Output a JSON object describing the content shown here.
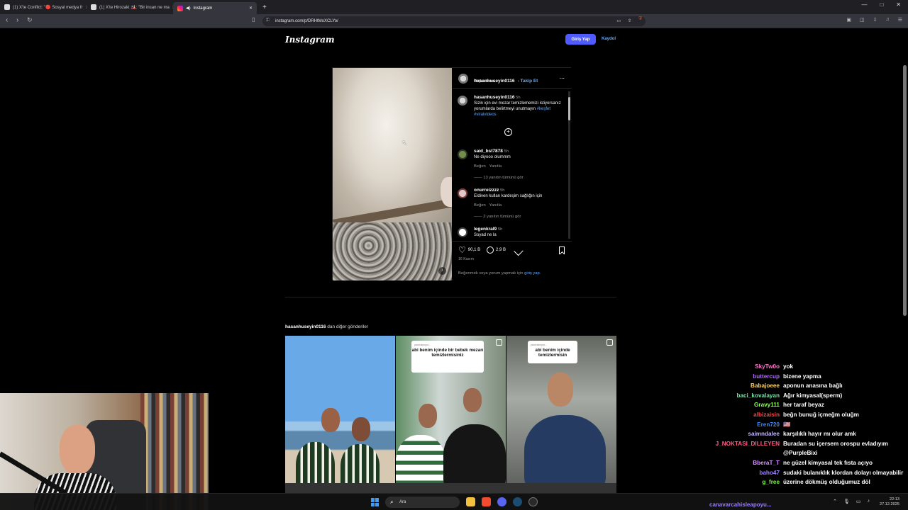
{
  "browser": {
    "tabs": [
      {
        "label": "(1) X'te Conflict: \"🔴 Sosyal medya fr"
      },
      {
        "label": "(1) X'te Hirozaki 🎎: \"Bir insan ne ma"
      },
      {
        "label": "Instagram"
      }
    ],
    "new_tab": "+",
    "url": "instagram.com/p/DRHtMoXCLYo/",
    "window_controls": [
      "—",
      "□",
      "✕"
    ]
  },
  "instagram": {
    "logo": "Instagram",
    "login_label": "Giriş Yap",
    "signup_label": "Kaydol",
    "post": {
      "author": "hasanhuseyin0116",
      "follow_label": "Takip Et",
      "audio": "Orijinal ses",
      "more_label": "...",
      "caption_time": "5h",
      "caption": "Sizin için evi mezar temizlememizi istiyorsanız yorumlarda belirtmeyi unutmayın",
      "hashtags": "#keşfet #viralvideos",
      "comments": [
        {
          "user": "said_bst7878",
          "time": "5h",
          "text": "Ne diyooo olummm",
          "like": "Beğen",
          "reply": "Yanıtla",
          "replies": "13 yanıtın tümünü gör"
        },
        {
          "user": "onurreizzzz",
          "time": "5h",
          "text": "Eldiven kullan kardeşim sağlığın için",
          "like": "Beğen",
          "reply": "Yanıtla",
          "replies": "2 yanıtın tümünü gör"
        },
        {
          "user": "legenkral9",
          "time": "5h",
          "text": "Soyad ne la"
        }
      ],
      "likes": "90,1 B",
      "comment_count": "2,9 B",
      "date": "16 Kasım",
      "login_prompt": "Beğenmek veya yorum yapmak için",
      "login_link": "giriş yap."
    },
    "more_posts": {
      "username": "hasanhuseyin0116",
      "suffix": " dan diğer gönderiler",
      "thumb_captions": [
        "",
        "abi benim içinde bir bebek mezarı temizlermisiniz",
        "abi benim içinde temizlermisin"
      ],
      "thumb_small": [
        "",
        "yanıt alınıyor...",
        "yanıt alınıyor..."
      ]
    }
  },
  "chat": [
    {
      "name": "SkyTw0o",
      "msg": "yok",
      "color": "#ff73c7"
    },
    {
      "name": "buttercup",
      "msg": "bizene yapma",
      "color": "#b267ff"
    },
    {
      "name": "Babajoeee",
      "msg": "aponun anasına bağlı",
      "color": "#ffd45c"
    },
    {
      "name": "baci_kovalayan",
      "msg": "Ağır kimyasal(sperm)",
      "color": "#77e6a8"
    },
    {
      "name": "Gravy111",
      "msg": "her taraf beyaz",
      "color": "#91ff59"
    },
    {
      "name": "albizaisin",
      "msg": "beğn bunuğ içmeğm oluğm",
      "color": "#ff4545"
    },
    {
      "name": "Eren720",
      "msg": "🇺🇸",
      "color": "#3f89ff"
    },
    {
      "name": "saimndalee",
      "msg": "karşılıklı hayır mı olur amk",
      "color": "#c3b3ff"
    },
    {
      "name": "J_NOKTASI_DILLEYEN",
      "msg": "Buradan su içersem orospu evladıyım @PurpleBixi",
      "color": "#ff5b85"
    },
    {
      "name": "BberaT_T",
      "msg": "ne güzel kimyasal tek fısta açıyo",
      "color": "#d896ff"
    },
    {
      "name": "baho47",
      "msg": "sudaki bulanıklık klordan dolayı olmayabilir",
      "color": "#a080ff"
    },
    {
      "name": "g_free",
      "msg": "üzerine dökmüş olduğumuz döl",
      "color": "#76ff42"
    }
  ],
  "chat_input": "canavarcahisleapoyu...",
  "taskbar": {
    "search": "Ara",
    "time": "22:13",
    "date": "27.12.2025"
  }
}
